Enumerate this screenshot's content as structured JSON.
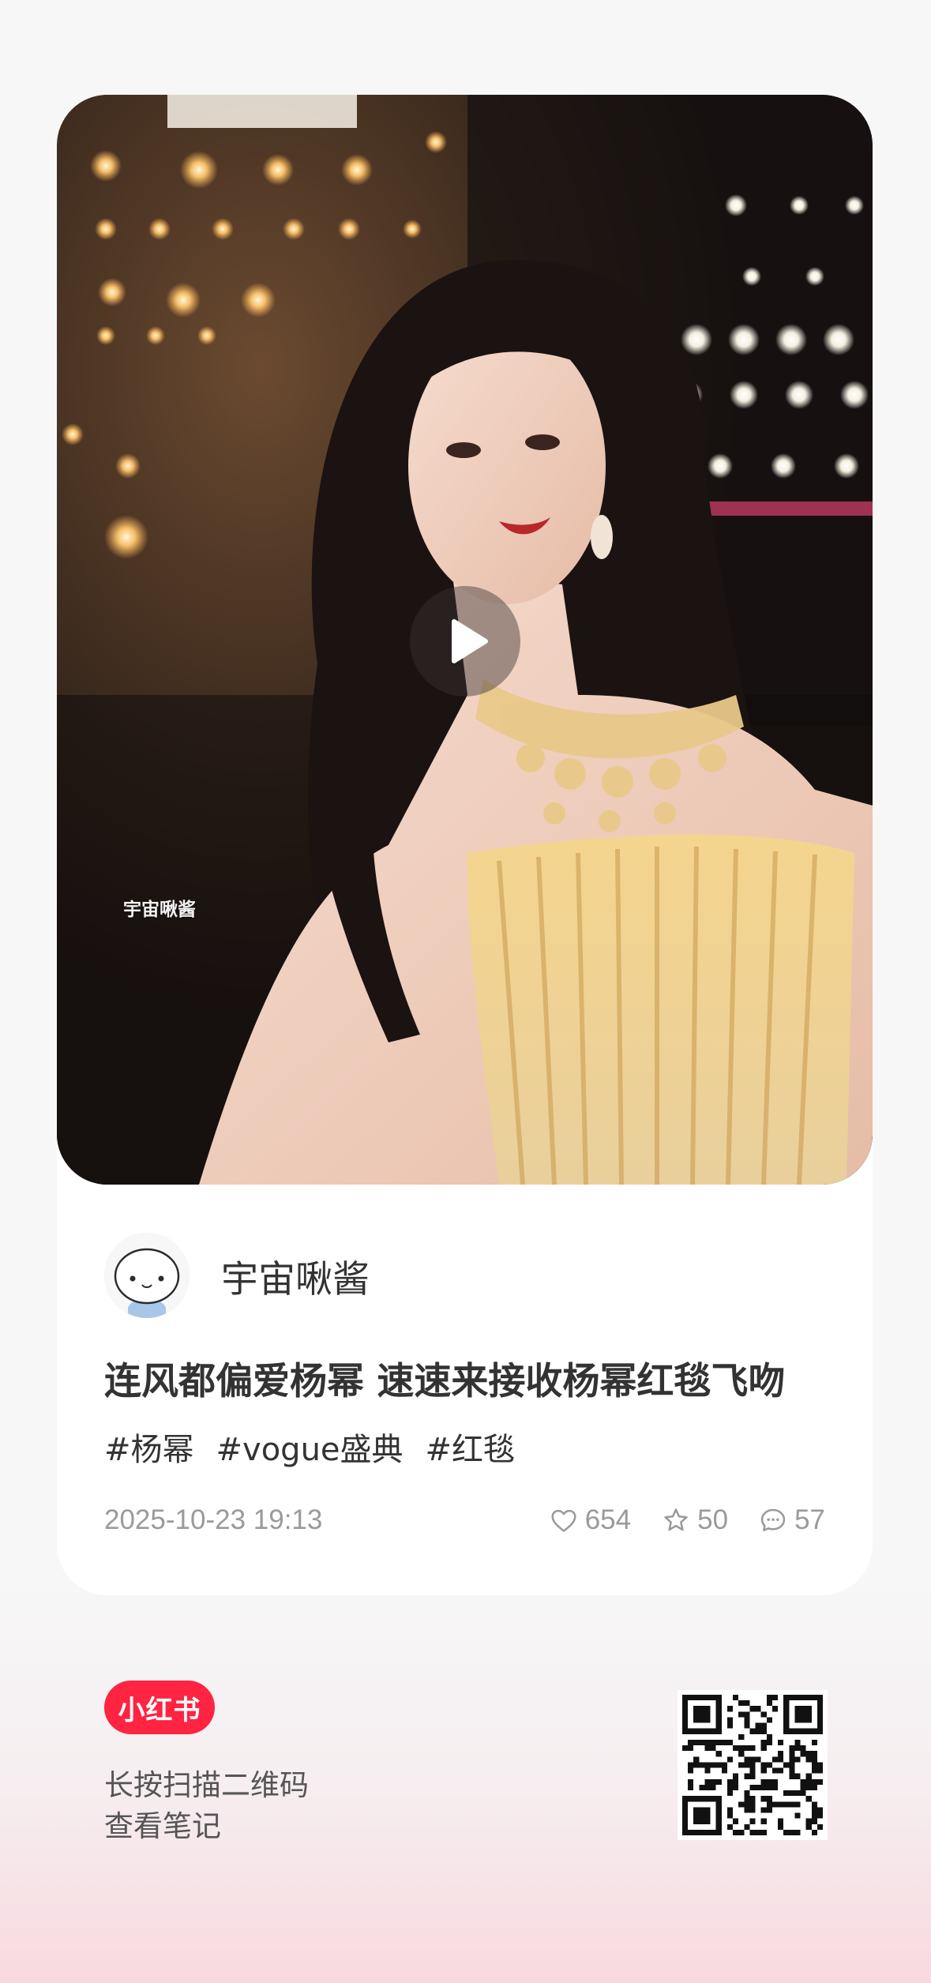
{
  "media": {
    "watermark": "宇宙啾酱",
    "play_icon": "play-icon"
  },
  "author": {
    "name": "宇宙啾酱",
    "avatar_icon": "cartoon-avatar"
  },
  "note": {
    "title": "连风都偏爱杨幂 速速来接收杨幂红毯飞吻",
    "tags": [
      "#杨幂",
      "#vogue盛典",
      "#红毯"
    ]
  },
  "meta": {
    "timestamp": "2025-10-23 19:13",
    "likes": "654",
    "collects": "50",
    "comments": "57"
  },
  "footer": {
    "brand": "小红书",
    "hint_line1": "长按扫描二维码",
    "hint_line2": "查看笔记"
  },
  "colors": {
    "brand": "#ff2442",
    "meta_text": "#9a9a9a"
  }
}
